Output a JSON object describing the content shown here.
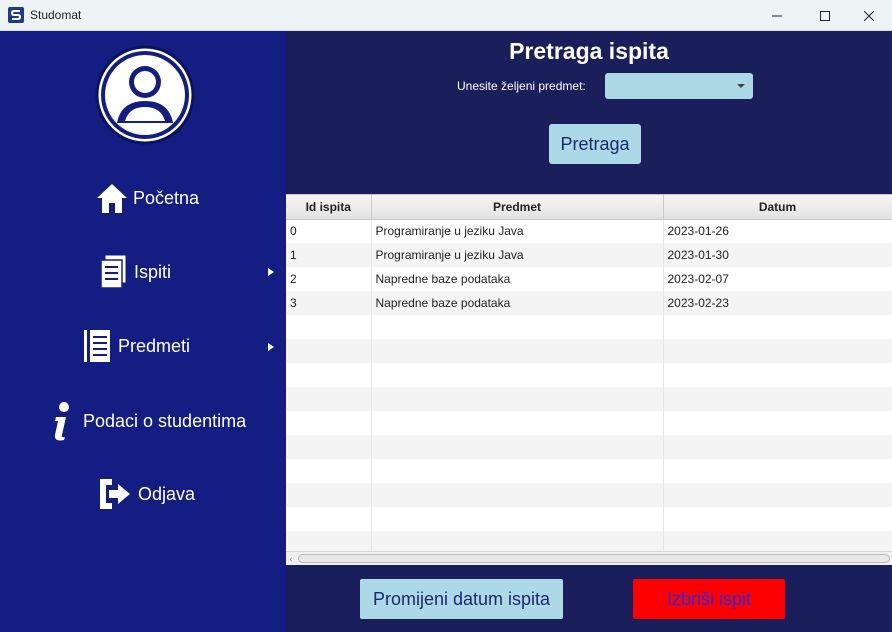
{
  "window": {
    "title": "Studomat"
  },
  "sidebar": {
    "items": [
      {
        "label": "Početna",
        "icon": "home-icon",
        "has_submenu": false
      },
      {
        "label": "Ispiti",
        "icon": "document-icon",
        "has_submenu": true
      },
      {
        "label": "Predmeti",
        "icon": "book-icon",
        "has_submenu": true
      },
      {
        "label": "Podaci o studentima",
        "icon": "info-icon",
        "has_submenu": false
      },
      {
        "label": "Odjava",
        "icon": "logout-icon",
        "has_submenu": false
      }
    ]
  },
  "header": {
    "title": "Pretraga ispita",
    "subject_label": "Unesite željeni predmet:",
    "subject_value": "",
    "search_label": "Pretraga"
  },
  "table": {
    "columns": [
      "Id ispita",
      "Predmet",
      "Datum"
    ],
    "rows": [
      [
        "0",
        "Programiranje u jeziku Java",
        "2023-01-26"
      ],
      [
        "1",
        "Programiranje u jeziku Java",
        "2023-01-30"
      ],
      [
        "2",
        "Napredne baze podataka",
        "2023-02-07"
      ],
      [
        "3",
        "Napredne baze podataka",
        "2023-02-23"
      ]
    ]
  },
  "footer": {
    "change_date_label": "Promijeni datum ispita",
    "delete_label": "Izbriši ispit"
  },
  "colors": {
    "sidebar_bg": "#141d82",
    "main_bg": "#1a1f5c",
    "accent_button": "#add8e6",
    "delete_button": "#ff0000"
  }
}
